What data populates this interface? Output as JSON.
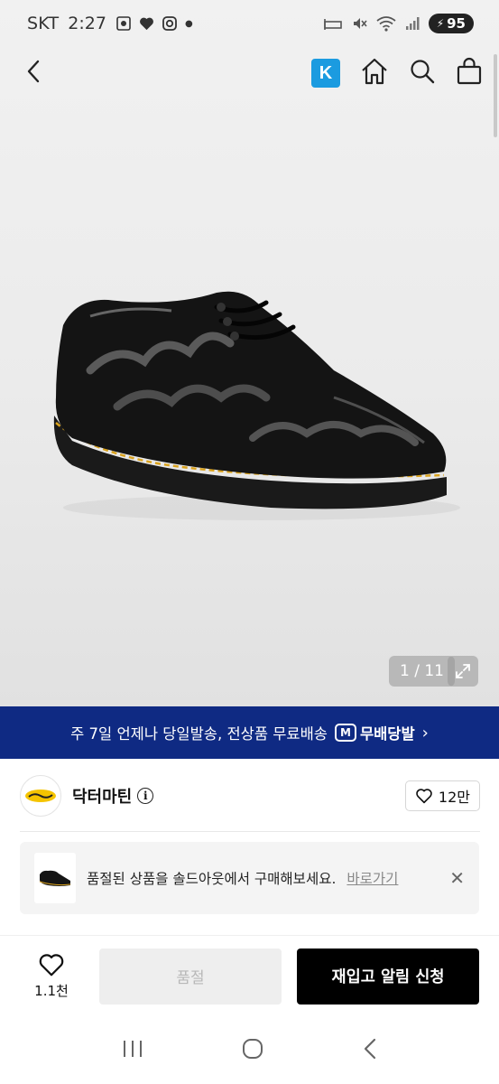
{
  "status_bar": {
    "carrier": "SKT",
    "time": "2:27",
    "battery": "95"
  },
  "nav": {
    "back_icon": "chevron-left-icon",
    "k_badge": "K",
    "home_icon": "home-icon",
    "search_icon": "search-icon",
    "bag_icon": "shopping-bag-icon"
  },
  "image_pager": {
    "text": "1 / 11"
  },
  "shipping_banner": {
    "text": "주 7일 언제나 당일발송, 전상품 무료배송",
    "badge_letter": "M",
    "badge_text": "무배당발",
    "chevron": "›"
  },
  "brand": {
    "name": "닥터마틴",
    "like_count": "12만"
  },
  "soldout_notice": {
    "text": "품절된 상품을 솔드아웃에서 구매해보세요.",
    "link": "바로가기",
    "close": "✕"
  },
  "actions": {
    "wish_count": "1.1천",
    "soldout_label": "품절",
    "restock_label": "재입고 알림 신청"
  },
  "colors": {
    "banner": "#0f2a83",
    "k_badge": "#1b9be0",
    "primary_button": "#000000",
    "disabled_button": "#eeeeee"
  }
}
